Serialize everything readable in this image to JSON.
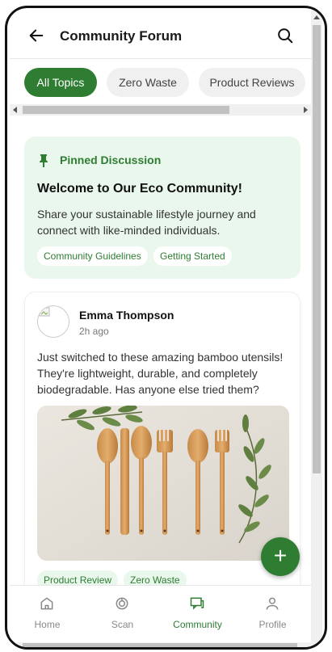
{
  "header": {
    "title": "Community Forum",
    "back_icon": "arrow-left-icon",
    "search_icon": "search-icon"
  },
  "chips": [
    {
      "label": "All Topics",
      "active": true
    },
    {
      "label": "Zero Waste",
      "active": false
    },
    {
      "label": "Product Reviews",
      "active": false
    }
  ],
  "pinned": {
    "label": "Pinned Discussion",
    "title": "Welcome to Our Eco Community!",
    "description": "Share your sustainable lifestyle journey and connect with like-minded individuals.",
    "tags": [
      "Community Guidelines",
      "Getting Started"
    ]
  },
  "post": {
    "author": "Emma Thompson",
    "time": "2h ago",
    "text": "Just switched to these amazing bamboo utensils! They're lightweight, durable, and completely biodegradable. Has anyone else tried them?",
    "tags": [
      "Product Review",
      "Zero Waste"
    ]
  },
  "fab": {
    "label": "+"
  },
  "nav": [
    {
      "label": "Home",
      "icon": "home-icon",
      "active": false
    },
    {
      "label": "Scan",
      "icon": "scan-icon",
      "active": false
    },
    {
      "label": "Community",
      "icon": "chat-icon",
      "active": true
    },
    {
      "label": "Profile",
      "icon": "user-icon",
      "active": false
    }
  ],
  "colors": {
    "accent": "#2e7d32",
    "pinned_bg": "#e9f7ec",
    "inactive_chip": "#f0f0f0"
  }
}
